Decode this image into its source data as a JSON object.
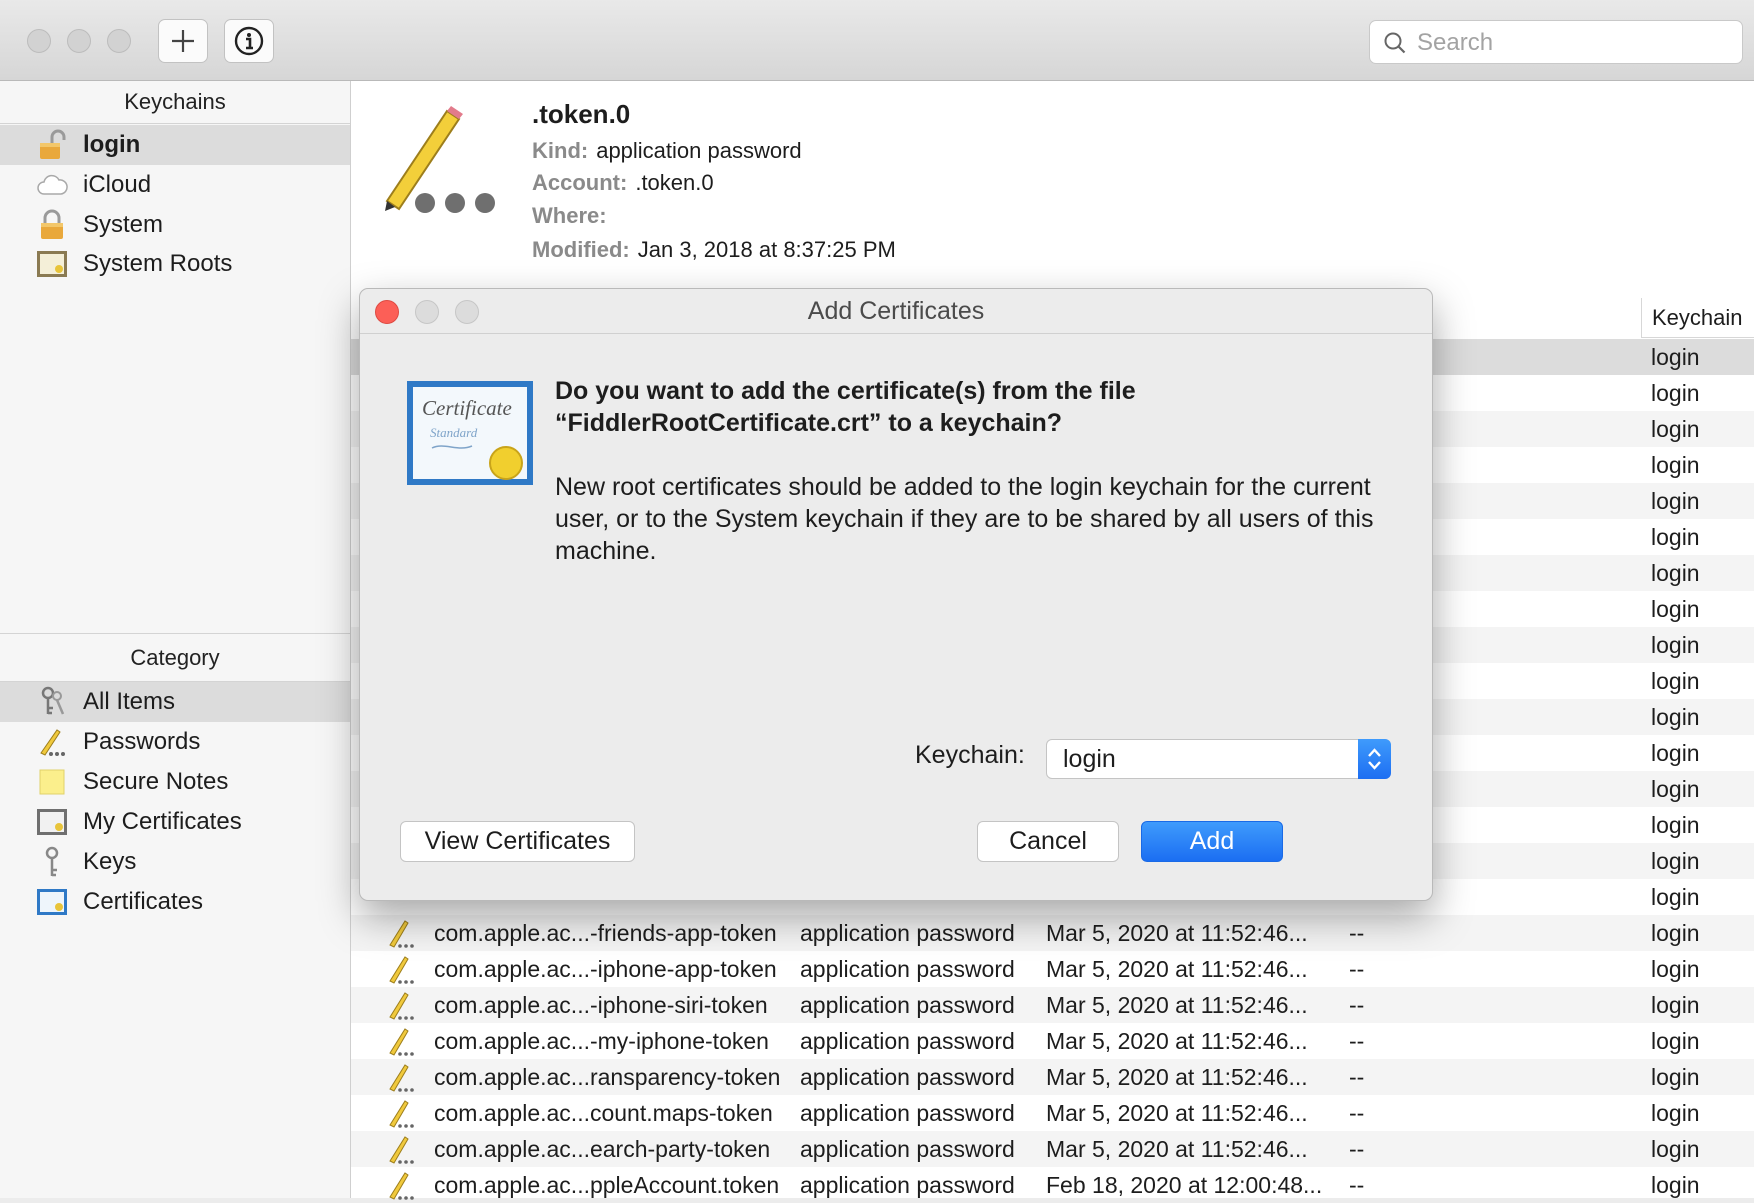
{
  "toolbar": {
    "search_placeholder": "Search"
  },
  "sidebar": {
    "keychains_header": "Keychains",
    "keychains": [
      {
        "label": "login"
      },
      {
        "label": "iCloud"
      },
      {
        "label": "System"
      },
      {
        "label": "System Roots"
      }
    ],
    "category_header": "Category",
    "categories": [
      {
        "label": "All Items"
      },
      {
        "label": "Passwords"
      },
      {
        "label": "Secure Notes"
      },
      {
        "label": "My Certificates"
      },
      {
        "label": "Keys"
      },
      {
        "label": "Certificates"
      }
    ]
  },
  "item_info": {
    "title": ".token.0",
    "kind_label": "Kind:",
    "kind_value": "application password",
    "account_label": "Account:",
    "account_value": ".token.0",
    "where_label": "Where:",
    "where_value": "",
    "modified_label": "Modified:",
    "modified_value": "Jan 3, 2018 at 8:37:25 PM"
  },
  "table": {
    "keychain_header": "Keychain",
    "hidden_keychain_values": [
      "login",
      "login",
      "login",
      "login",
      "login",
      "login",
      "login",
      "login",
      "login",
      "login",
      "login",
      "login",
      "login",
      "login",
      "login",
      "login"
    ],
    "rows": [
      {
        "name": "com.apple.ac...-friends-app-token",
        "kind": "application password",
        "date": "Mar 5, 2020 at 11:52:46...",
        "expires": "--",
        "keychain": "login"
      },
      {
        "name": "com.apple.ac...-iphone-app-token",
        "kind": "application password",
        "date": "Mar 5, 2020 at 11:52:46...",
        "expires": "--",
        "keychain": "login"
      },
      {
        "name": "com.apple.ac...-iphone-siri-token",
        "kind": "application password",
        "date": "Mar 5, 2020 at 11:52:46...",
        "expires": "--",
        "keychain": "login"
      },
      {
        "name": "com.apple.ac...-my-iphone-token",
        "kind": "application password",
        "date": "Mar 5, 2020 at 11:52:46...",
        "expires": "--",
        "keychain": "login"
      },
      {
        "name": "com.apple.ac...ransparency-token",
        "kind": "application password",
        "date": "Mar 5, 2020 at 11:52:46...",
        "expires": "--",
        "keychain": "login"
      },
      {
        "name": "com.apple.ac...count.maps-token",
        "kind": "application password",
        "date": "Mar 5, 2020 at 11:52:46...",
        "expires": "--",
        "keychain": "login"
      },
      {
        "name": "com.apple.ac...earch-party-token",
        "kind": "application password",
        "date": "Mar 5, 2020 at 11:52:46...",
        "expires": "--",
        "keychain": "login"
      },
      {
        "name": "com.apple.ac...ppleAccount.token",
        "kind": "application password",
        "date": "Feb 18, 2020 at 12:00:48...",
        "expires": "--",
        "keychain": "login"
      }
    ]
  },
  "dialog": {
    "title": "Add Certificates",
    "question": "Do you want to add the certificate(s) from the file “FiddlerRootCertificate.crt” to a keychain?",
    "description": "New root certificates should be added to the login keychain for the current user, or to the System keychain if they are to be shared by all users of this machine.",
    "keychain_label": "Keychain:",
    "keychain_value": "login",
    "view_certificates_label": "View Certificates",
    "cancel_label": "Cancel",
    "add_label": "Add",
    "icon_text_line1": "Certificate",
    "icon_text_line2": "Standard"
  },
  "colors": {
    "accent": "#1b6ef2",
    "close_red": "#fc5f57"
  },
  "icons": [
    "plus-icon",
    "info-icon",
    "search-icon",
    "lock-open-icon",
    "cloud-icon",
    "lock-icon",
    "certificate-icon",
    "keys-icon",
    "pencil-icon",
    "note-icon",
    "key-icon"
  ]
}
